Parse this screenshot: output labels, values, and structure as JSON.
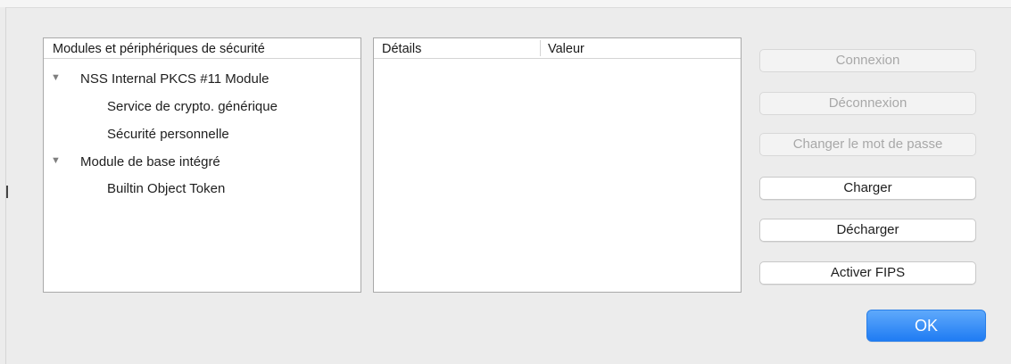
{
  "modules_panel": {
    "header": "Modules et périphériques de sécurité",
    "tree": [
      {
        "label": "NSS Internal PKCS #11 Module",
        "twisty": "▼"
      },
      {
        "label": "Service de crypto. générique"
      },
      {
        "label": "Sécurité personnelle"
      },
      {
        "label": "Module de base intégré",
        "twisty": "▼"
      },
      {
        "label": "Builtin Object Token"
      }
    ]
  },
  "details_panel": {
    "col_details": "Détails",
    "col_value": "Valeur"
  },
  "buttons": {
    "login": "Connexion",
    "logout": "Déconnexion",
    "change_password": "Changer le mot de passe",
    "load": "Charger",
    "unload": "Décharger",
    "enable_fips": "Activer FIPS",
    "ok": "OK"
  },
  "colors": {
    "accent": "#1f7cf3",
    "disabled_text": "#a8a8a8"
  }
}
